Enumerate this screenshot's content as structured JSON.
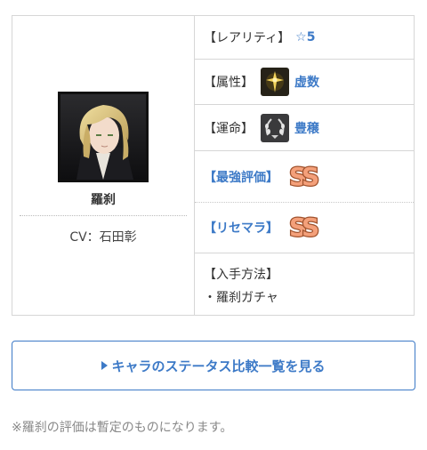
{
  "character": {
    "name": "羅刹",
    "cv": "CV：石田彰"
  },
  "rarity": {
    "label": "【レアリティ】",
    "star": "☆",
    "value": "5"
  },
  "attribute": {
    "label": "【属性】",
    "icon": "attribute-cross-icon",
    "value": "虚数"
  },
  "destiny": {
    "label": "【運命】",
    "icon": "destiny-wreath-icon",
    "value": "豊穣"
  },
  "best_rating": {
    "label": "【最強評価】",
    "grade_icon": "ss-grade-icon"
  },
  "reroll_rating": {
    "label": "【リセマラ】",
    "grade_icon": "ss-grade-icon"
  },
  "obtain": {
    "title": "【入手方法】",
    "item": "・羅刹ガチャ"
  },
  "compare_button": {
    "label": "キャラのステータス比較一覧を見る"
  },
  "note": "※羅刹の評価は暫定のものになります。",
  "colors": {
    "accent": "#3d7ac7",
    "border": "#d6d6d6",
    "note": "#888888"
  }
}
